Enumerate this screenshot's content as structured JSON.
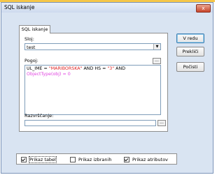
{
  "window": {
    "title": "SQL iskanje",
    "close_label": "x"
  },
  "tabs": [
    {
      "label": "SQL iskanje"
    }
  ],
  "form": {
    "sloj_label": "Sloj:",
    "sloj_value": "test",
    "pogoj_label": "Pogoj:",
    "pogoj_button": "...",
    "query": {
      "p1": "UL_IME = ",
      "p2": "\"MARIBORSKA\"",
      "p3": " AND HS = ",
      "p4": "\"3\"",
      "p5": " AND",
      "p6": "ObjectType",
      "p7": "(obj) = 0"
    },
    "razvrscanje_label": "Razvrščanje:",
    "razvrscanje_value": "",
    "razvrscanje_button": "..."
  },
  "buttons": {
    "ok": "V redu",
    "cancel": "Prekliči",
    "clear": "Počisti"
  },
  "options": {
    "tabel": {
      "label": "Prikaz tabel",
      "checked": true
    },
    "izbranih": {
      "label": "Prikaz izbranih",
      "checked": false
    },
    "atributov": {
      "label": "Prikaz atributov",
      "checked": true
    }
  },
  "colors": {
    "string_literal": "#d22222",
    "function": "#e044e0",
    "close_button": "#c8452b"
  },
  "icons": {
    "close": "close-icon",
    "combo_arrow": "chevron-down-icon"
  }
}
